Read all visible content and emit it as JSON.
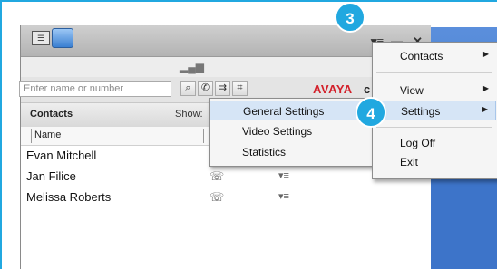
{
  "app": {
    "search_placeholder": "Enter name or number",
    "brand": "AVAYA",
    "brand_suffix": "c",
    "contacts_title": "Contacts",
    "show_label": "Show:",
    "column_name": "Name"
  },
  "contacts": [
    {
      "name": "Evan Mitchell"
    },
    {
      "name": "Jan Filice"
    },
    {
      "name": "Melissa Roberts"
    }
  ],
  "main_menu": {
    "items": [
      {
        "label": "Contacts",
        "has_submenu": true
      },
      {
        "label": "View",
        "has_submenu": true
      },
      {
        "label": "Settings",
        "has_submenu": true,
        "highlighted": true
      },
      {
        "label": "Log Off",
        "has_submenu": false
      },
      {
        "label": "Exit",
        "has_submenu": false
      }
    ]
  },
  "settings_submenu": {
    "items": [
      {
        "label": "General Settings",
        "highlighted": true
      },
      {
        "label": "Video Settings"
      },
      {
        "label": "Statistics"
      }
    ]
  },
  "callouts": {
    "step_3": "3",
    "step_4": "4"
  },
  "colors": {
    "accent": "#21a8e0",
    "brand_red": "#d3202a",
    "menu_highlight": "#d6e5f6"
  },
  "icons": {
    "menu": "menu-icon",
    "minimize": "minimize-icon",
    "close": "close-icon",
    "search": "search-icon",
    "phone": "phone-icon",
    "dialpad": "dialpad-icon"
  }
}
